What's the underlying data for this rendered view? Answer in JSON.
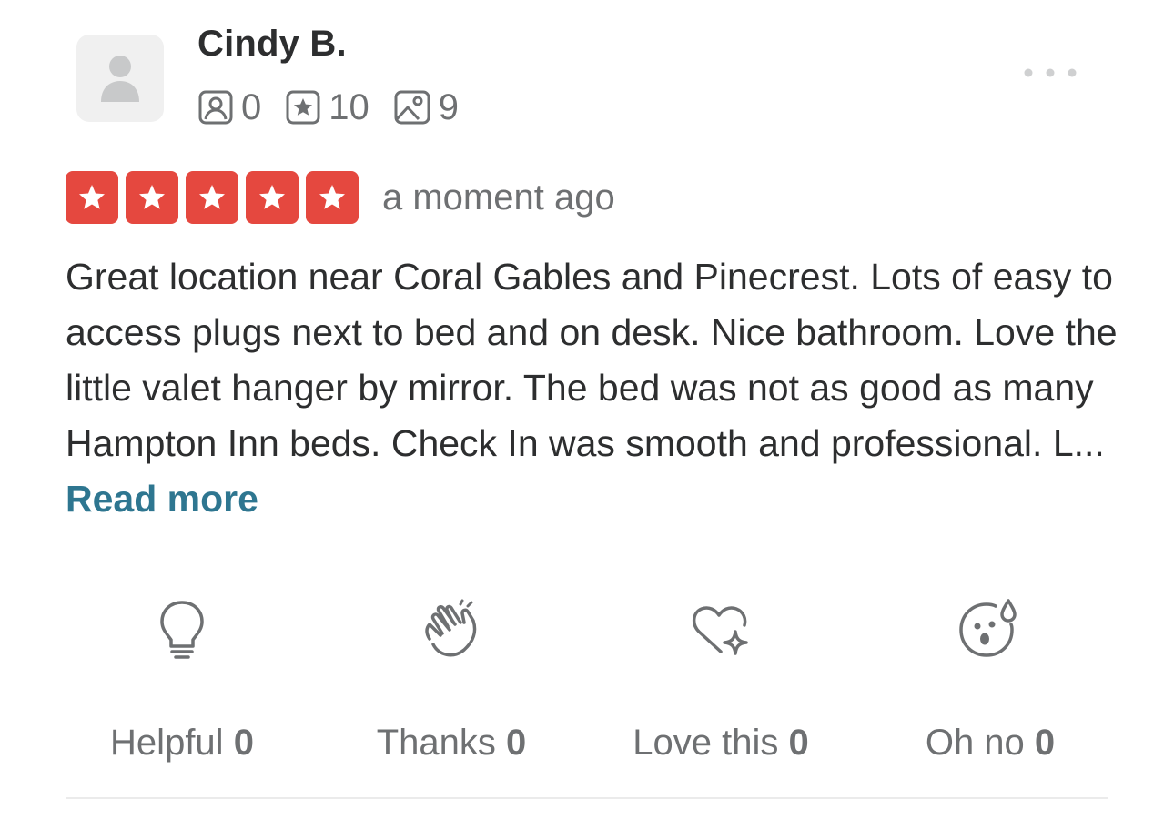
{
  "user": {
    "name": "Cindy B.",
    "avatar_icon": "person-silhouette-icon",
    "stats": [
      {
        "icon": "friends-icon",
        "value": "0"
      },
      {
        "icon": "reviews-star-icon",
        "value": "10"
      },
      {
        "icon": "photos-icon",
        "value": "9"
      }
    ]
  },
  "menu": {
    "icon": "more-options-icon"
  },
  "rating": {
    "stars": 5,
    "max_stars": 5,
    "color": "#e5483f",
    "timestamp": "a moment ago"
  },
  "review": {
    "text": "Great location near Coral Gables and Pinecrest. Lots of easy to access plugs next to bed and on desk. Nice bathroom. Love the little valet hanger by mirror. The bed was not as good as many Hampton Inn beds. Check In was smooth and professional. L...",
    "read_more": "Read more",
    "link_color": "#2e7690"
  },
  "reactions": [
    {
      "icon": "lightbulb-icon",
      "label": "Helpful",
      "count": "0"
    },
    {
      "icon": "clapping-hands-icon",
      "label": "Thanks",
      "count": "0"
    },
    {
      "icon": "heart-sparkle-icon",
      "label": "Love this",
      "count": "0"
    },
    {
      "icon": "surprised-face-icon",
      "label": "Oh no",
      "count": "0"
    }
  ]
}
